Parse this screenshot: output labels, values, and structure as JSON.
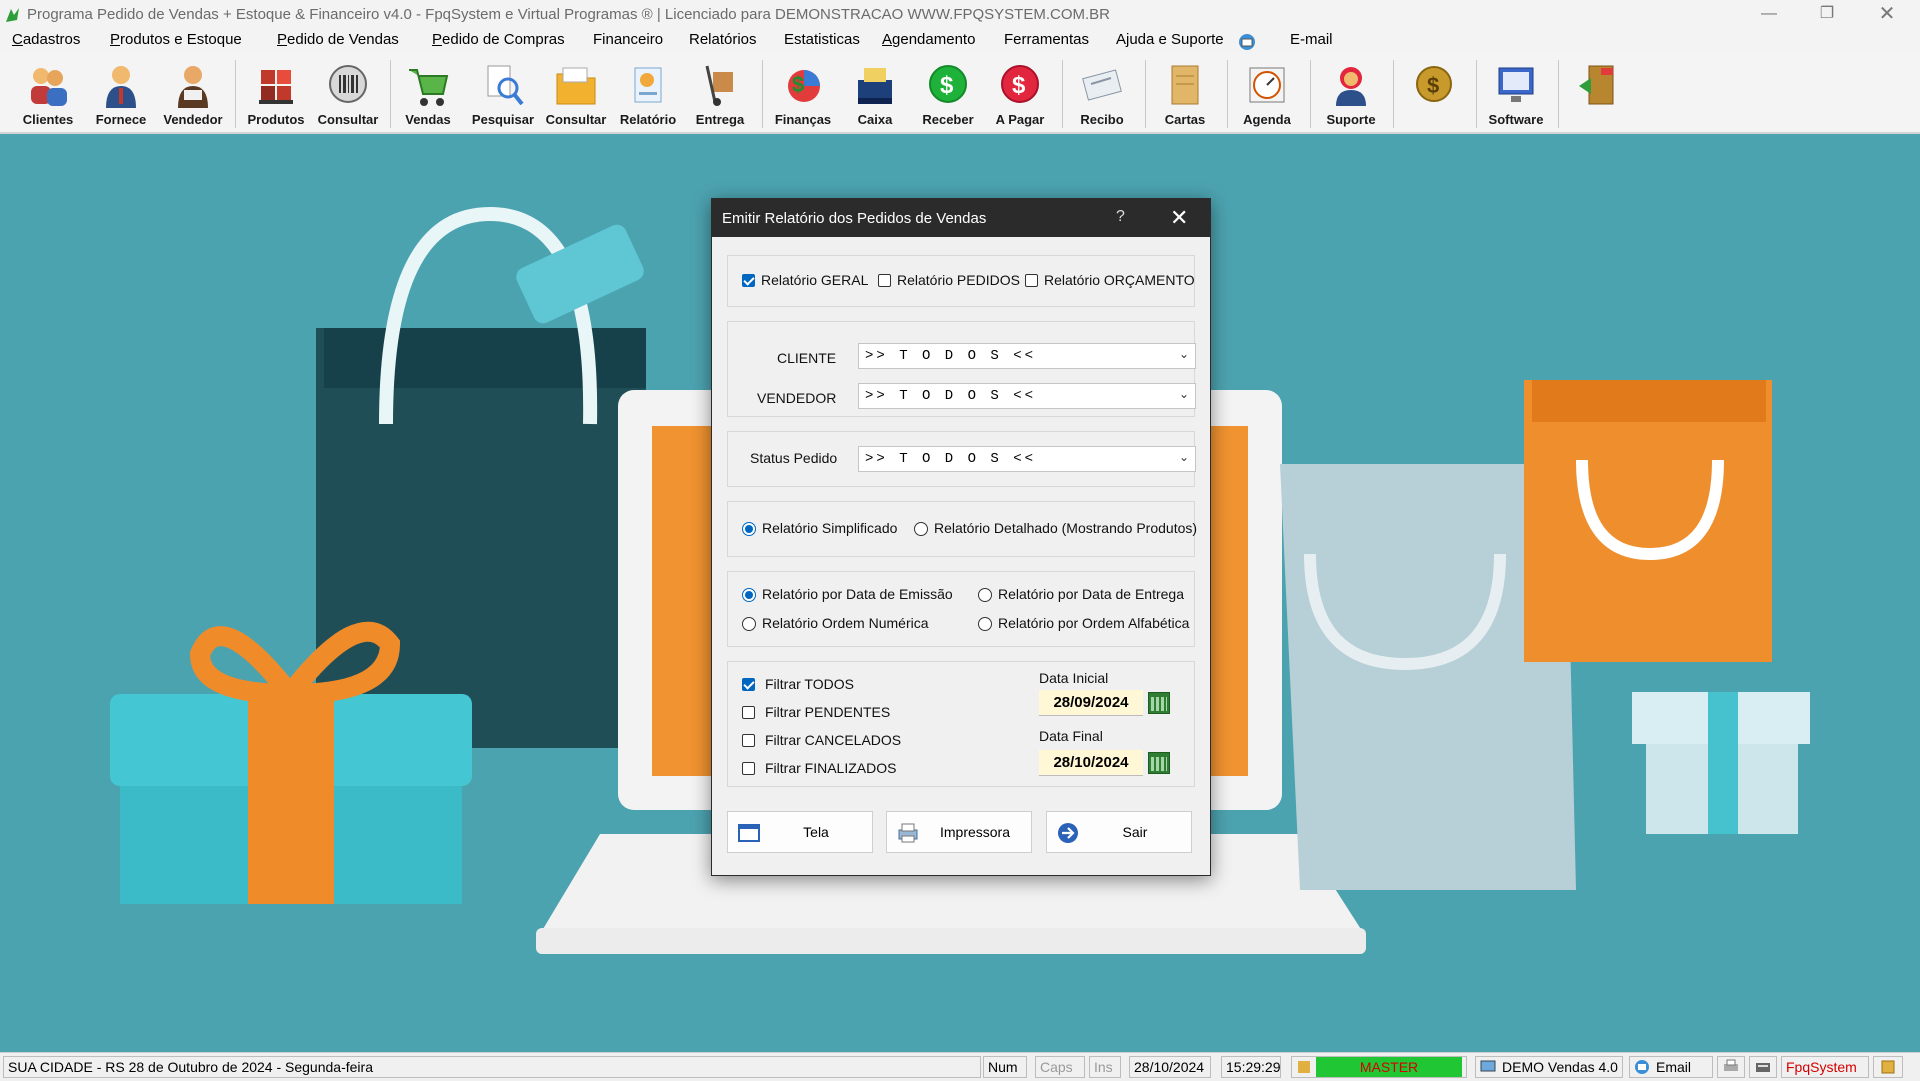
{
  "window": {
    "title": "Programa Pedido de Vendas + Estoque & Financeiro v4.0 - FpqSystem e Virtual Programas ® | Licenciado para  DEMONSTRACAO WWW.FPQSYSTEM.COM.BR"
  },
  "menu": [
    "Cadastros",
    "Produtos e Estoque",
    "Pedido de Vendas",
    "Pedido de Compras",
    "Financeiro",
    "Relatórios",
    "Estatisticas",
    "Agendamento",
    "Ferramentas",
    "Ajuda e Suporte",
    "E-mail"
  ],
  "toolbar": [
    "Clientes",
    "Fornece",
    "Vendedor",
    "Produtos",
    "Consultar",
    "Vendas",
    "Pesquisar",
    "Consultar",
    "Relatório",
    "Entrega",
    "Finanças",
    "Caixa",
    "Receber",
    "A Pagar",
    "Recibo",
    "Cartas",
    "Agenda",
    "Suporte",
    "",
    "Software",
    ""
  ],
  "dialog": {
    "title": "Emitir Relatório dos Pedidos de Vendas",
    "help": "?",
    "close": "✕",
    "report_types": [
      {
        "label": "Relatório GERAL",
        "checked": true
      },
      {
        "label": "Relatório PEDIDOS",
        "checked": false
      },
      {
        "label": "Relatório ORÇAMENTO",
        "checked": false
      }
    ],
    "cliente_label": "CLIENTE",
    "cliente_value": ">> T O D O S <<",
    "vendedor_label": "VENDEDOR",
    "vendedor_value": ">> T O D O S <<",
    "status_label": "Status Pedido",
    "status_value": ">> T O D O S <<",
    "detail_options": [
      {
        "label": "Relatório Simplificado",
        "selected": true
      },
      {
        "label": "Relatório Detalhado (Mostrando Produtos)",
        "selected": false
      }
    ],
    "order_options": [
      {
        "label": "Relatório por Data de Emissão",
        "selected": true
      },
      {
        "label": "Relatório por Data de Entrega",
        "selected": false
      },
      {
        "label": "Relatório Ordem Numérica",
        "selected": false
      },
      {
        "label": "Relatório por Ordem Alfabética",
        "selected": false
      }
    ],
    "filters": [
      {
        "label": "Filtrar TODOS",
        "checked": true
      },
      {
        "label": "Filtrar PENDENTES",
        "checked": false
      },
      {
        "label": "Filtrar CANCELADOS",
        "checked": false
      },
      {
        "label": "Filtrar FINALIZADOS",
        "checked": false
      }
    ],
    "data_inicial_label": "Data Inicial",
    "data_inicial": "28/09/2024",
    "data_final_label": "Data Final",
    "data_final": "28/10/2024",
    "buttons": {
      "tela": "Tela",
      "impressora": "Impressora",
      "sair": "Sair"
    }
  },
  "statusbar": {
    "location": "SUA CIDADE - RS 28 de Outubro de 2024 - Segunda-feira",
    "num": "Num",
    "caps": "Caps",
    "ins": "Ins",
    "date": "28/10/2024",
    "time": "15:29:29",
    "user": "MASTER",
    "version": "DEMO Vendas 4.0",
    "email": "Email",
    "brand": "FpqSystem"
  },
  "colors": {
    "background": "#4ca3b0",
    "dialog_title": "#2b2b2b",
    "accent": "#0067c0",
    "master_badge": "#21c634",
    "brand_text": "#d40000"
  }
}
